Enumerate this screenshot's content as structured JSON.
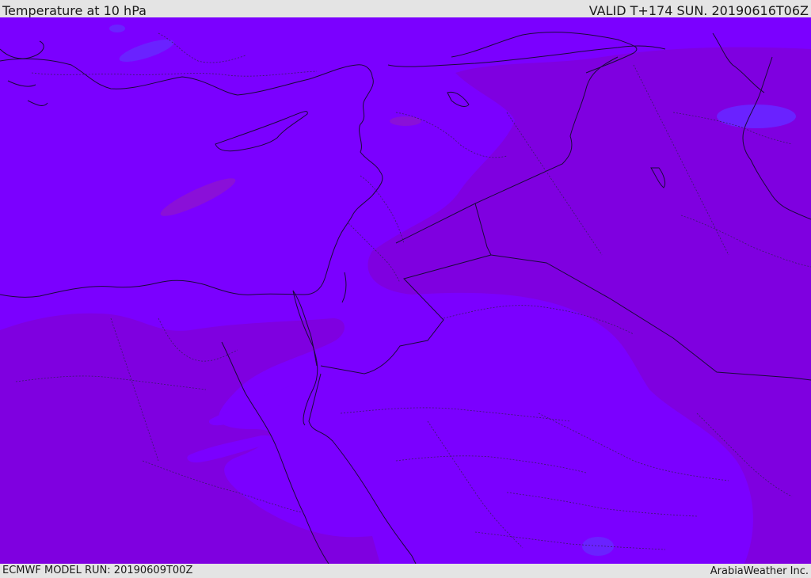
{
  "header": {
    "title": "Temperature at 10 hPa",
    "valid": "VALID T+174 SUN. 20190616T06Z"
  },
  "footer": {
    "model_run": "ECMWF MODEL RUN: 20190609T00Z",
    "brand": "ArabiaWeather Inc."
  },
  "colors": {
    "base_fill": "#7b00ff",
    "warm_band": "#7f00e0",
    "cool_patch": "#6a22ff",
    "warm_patch": "#8a10d8",
    "lines": "#1a0a3a"
  }
}
